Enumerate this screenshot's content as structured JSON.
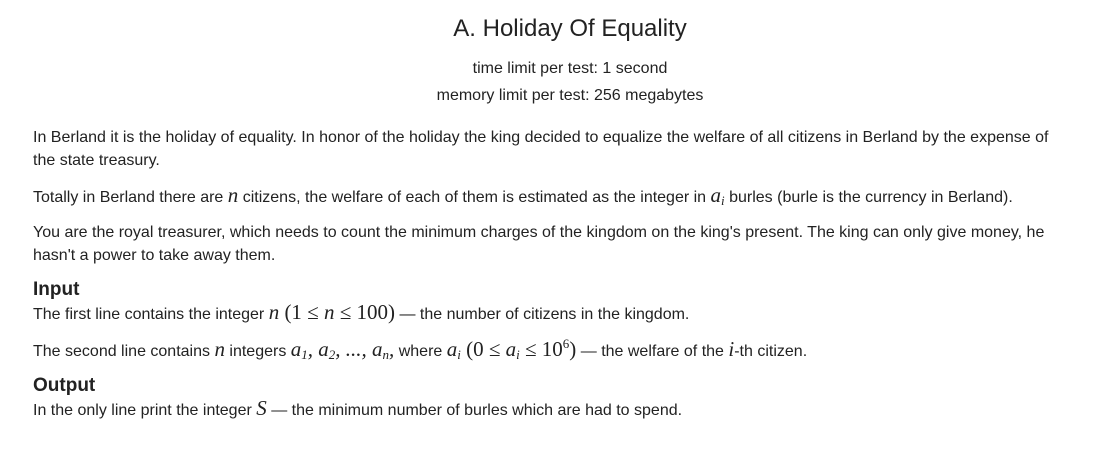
{
  "problem": {
    "title": "A. Holiday Of Equality",
    "time_limit": "time limit per test: 1 second",
    "memory_limit": "memory limit per test: 256 megabytes"
  },
  "statement": {
    "p1": "In Berland it is the holiday of equality. In honor of the holiday the king decided to equalize the welfare of all citizens in Berland by the expense of the state treasury.",
    "p2_a": "Totally in Berland there are ",
    "p2_var_n": "n",
    "p2_b": " citizens, the welfare of each of them is estimated as the integer in ",
    "p2_var_a": "a",
    "p2_sub_i": "i",
    "p2_c": " burles (burle is the currency in Berland).",
    "p3": "You are the royal treasurer, which needs to count the minimum charges of the kingdom on the king's present. The king can only give money, he hasn't a power to take away them."
  },
  "input_section": {
    "title": "Input",
    "line1_a": "The first line contains the integer ",
    "line1_var_n": "n",
    "line1_constraint_open": " (1 ≤ ",
    "line1_constraint_n": "n",
    "line1_constraint_close": " ≤ 100)",
    "line1_b": " — the number of citizens in the kingdom.",
    "line2_a": "The second line contains ",
    "line2_var_n": "n",
    "line2_b": " integers ",
    "line2_seq_a1": "a",
    "line2_seq_1": "1",
    "line2_seq_comma1": ", ",
    "line2_seq_a2": "a",
    "line2_seq_2": "2",
    "line2_seq_dots": ", ..., ",
    "line2_seq_an": "a",
    "line2_seq_n": "n",
    "line2_seq_comma2": ",",
    "line2_c": " where ",
    "line2_var_ai": "a",
    "line2_sub_i": "i",
    "line2_constraint_open": " (0 ≤ ",
    "line2_constraint_a": "a",
    "line2_constraint_sub_i": "i",
    "line2_constraint_le": " ≤ 10",
    "line2_constraint_exp": "6",
    "line2_constraint_close": ")",
    "line2_d": " — the welfare of the ",
    "line2_var_i": "i",
    "line2_e": "-th citizen."
  },
  "output_section": {
    "title": "Output",
    "line1_a": "In the only line print the integer ",
    "line1_var_s": "S",
    "line1_b": " — the minimum number of burles which are had to spend."
  }
}
